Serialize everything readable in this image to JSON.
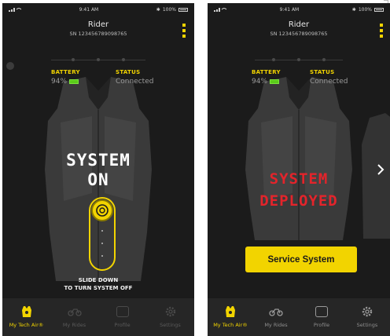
{
  "colors": {
    "accent": "#f2d400",
    "background": "#1b1b1b",
    "tab_bar": "#262626",
    "battery_green": "#5acb1a",
    "deployed_red": "#e3242b"
  },
  "screens": [
    {
      "status_bar": {
        "time": "9:41 AM",
        "battery": "100%"
      },
      "header": {
        "title": "Rider",
        "serial": "SN 123456789098765"
      },
      "stats": {
        "battery_label": "BATTERY",
        "battery_value": "94%",
        "status_label": "STATUS",
        "status_value": "Connected"
      },
      "system_text_line1": "SYSTEM",
      "system_text_line2": "ON",
      "slider_hint_line1": "SLIDE DOWN",
      "slider_hint_line2": "TO TURN SYSTEM OFF",
      "tabs": [
        {
          "label": "My Tech Air®",
          "icon": "vest-icon",
          "active": true
        },
        {
          "label": "My Rides",
          "icon": "motorcycle-icon",
          "active": false
        },
        {
          "label": "Profile",
          "icon": "id-card-icon",
          "active": false
        },
        {
          "label": "Settings",
          "icon": "gear-icon",
          "active": false
        }
      ]
    },
    {
      "status_bar": {
        "time": "9:41 AM",
        "battery": "100%"
      },
      "header": {
        "title": "Rider",
        "serial": "SN 123456789098765"
      },
      "stats": {
        "battery_label": "BATTERY",
        "battery_value": "94%",
        "status_label": "STATUS",
        "status_value": "Connected"
      },
      "system_text_line1": "SYSTEM",
      "system_text_line2": "DEPLOYED",
      "service_button_label": "Service System",
      "tabs": [
        {
          "label": "My Tech Air®",
          "icon": "vest-icon",
          "active": true
        },
        {
          "label": "My Rides",
          "icon": "motorcycle-icon",
          "active": false
        },
        {
          "label": "Profile",
          "icon": "id-card-icon",
          "active": false
        },
        {
          "label": "Settings",
          "icon": "gear-icon",
          "active": false
        }
      ]
    }
  ]
}
